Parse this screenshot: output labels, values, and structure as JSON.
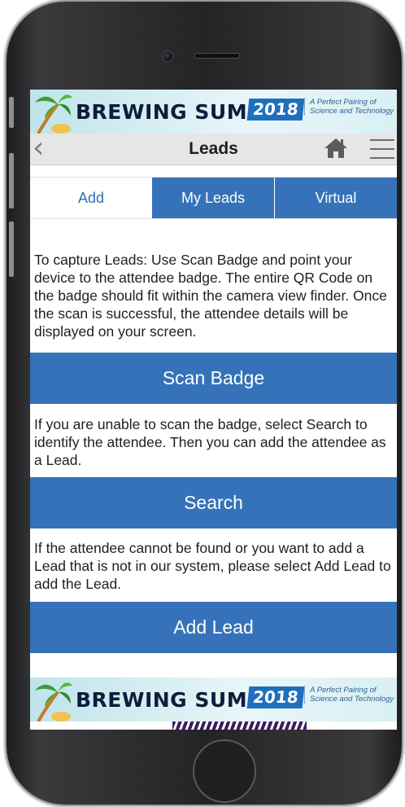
{
  "banner": {
    "title": "BREWING SUMMIT",
    "year": "2018",
    "tagline": "A Perfect Pairing of Science and Technology"
  },
  "header": {
    "title": "Leads",
    "back_icon": "chevron-left-icon",
    "home_icon": "home-icon",
    "menu_icon": "hamburger-menu-icon"
  },
  "tabs": [
    {
      "label": "Add",
      "active": true
    },
    {
      "label": "My Leads",
      "active": false
    },
    {
      "label": "Virtual",
      "active": false
    }
  ],
  "instructions": {
    "scan": "To capture Leads: Use Scan Badge and point your device to the attendee badge. The entire QR Code on the badge should fit within the camera view finder. Once the scan is successful, the attendee details will be displayed on your screen.",
    "search": "If you are unable to scan the badge, select Search to identify the attendee. Then you can add the attendee as a Lead.",
    "add": "If the attendee cannot be found or you want to add a Lead that is not in our system, please select Add Lead to add the Lead."
  },
  "buttons": {
    "scan_badge": "Scan Badge",
    "search": "Search",
    "add_lead": "Add Lead"
  },
  "colors": {
    "accent": "#3572b9",
    "navbar": "#e6e6e7",
    "banner_year": "#1f6fbf"
  }
}
